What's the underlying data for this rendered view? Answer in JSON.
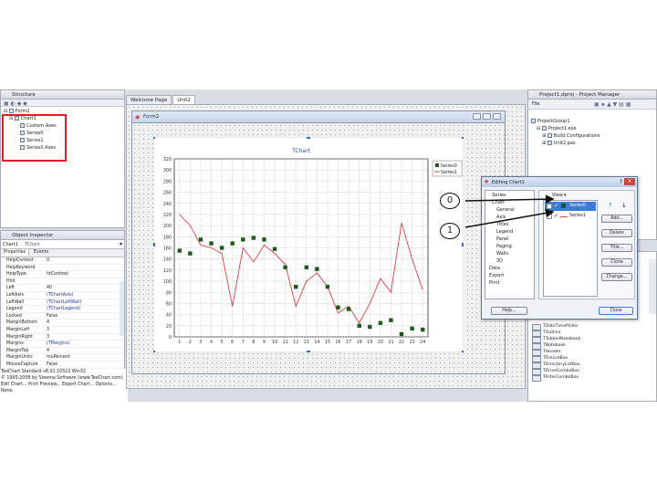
{
  "structure": {
    "title": "Structure",
    "tree": [
      "Form2",
      "Chart1",
      "Custom Axes",
      "Series0",
      "Series1",
      "Series0 Axes"
    ]
  },
  "inspector": {
    "title": "Object Inspector",
    "selector": "Chart1",
    "selector_type": "TChart",
    "tabs": [
      "Properties",
      "Events"
    ],
    "rows": [
      {
        "name": "HelpContext",
        "value": "0"
      },
      {
        "name": "HelpKeyword",
        "value": ""
      },
      {
        "name": "HelpType",
        "value": "htContext"
      },
      {
        "name": "Hint",
        "value": ""
      },
      {
        "name": "Left",
        "value": "40"
      },
      {
        "name": "LeftAxis",
        "value": "(TChartAxis)"
      },
      {
        "name": "LeftWall",
        "value": "(TChartLeftWall)"
      },
      {
        "name": "Legend",
        "value": "(TChartLegend)"
      },
      {
        "name": "Locked",
        "value": "False"
      },
      {
        "name": "MarginBottom",
        "value": "4"
      },
      {
        "name": "MarginLeft",
        "value": "3"
      },
      {
        "name": "MarginRight",
        "value": "3"
      },
      {
        "name": "Margins",
        "value": "(TMargins)"
      },
      {
        "name": "MarginTop",
        "value": "4"
      },
      {
        "name": "MarginUnits",
        "value": "muPercent"
      },
      {
        "name": "MouseCapture",
        "value": "False"
      },
      {
        "name": "Name",
        "value": "Chart1"
      }
    ],
    "status": [
      "TeeChart Standard v8.01.10522 Win32",
      "© 1995-2008 by Steema Software (www.TeeChart.com)",
      "Edit Chart... Print Preview... Export Chart... Options..."
    ],
    "footer": "None"
  },
  "tabs": [
    "Welcome Page",
    "Unit2"
  ],
  "form": {
    "title": "Form2"
  },
  "chart_data": {
    "type": "line",
    "title": "TChart",
    "x": [
      1,
      2,
      3,
      4,
      5,
      6,
      7,
      8,
      9,
      10,
      11,
      12,
      13,
      14,
      15,
      16,
      17,
      18,
      19,
      20,
      21,
      22,
      23,
      24
    ],
    "ylim": [
      0,
      320
    ],
    "yticks": [
      0,
      20,
      40,
      60,
      80,
      100,
      120,
      140,
      160,
      180,
      200,
      220,
      240,
      260,
      280,
      300,
      320
    ],
    "grid": true,
    "legend_position": "top-right",
    "series": [
      {
        "name": "Series0",
        "style": "points",
        "color": "#1e5a1e",
        "values": [
          155,
          150,
          175,
          168,
          160,
          168,
          175,
          178,
          175,
          158,
          125,
          90,
          125,
          122,
          90,
          53,
          50,
          20,
          18,
          25,
          30,
          5,
          15,
          13
        ]
      },
      {
        "name": "Series1",
        "style": "line",
        "color": "#e0403f",
        "values": [
          220,
          200,
          165,
          160,
          150,
          55,
          160,
          135,
          165,
          150,
          130,
          55,
          100,
          115,
          90,
          43,
          55,
          25,
          60,
          105,
          80,
          205,
          140,
          85
        ]
      }
    ]
  },
  "editor": {
    "title": "Editing Chart1",
    "tree": [
      "Series",
      "Chart",
      "General",
      "Axis",
      "Titles",
      "Legend",
      "Panel",
      "Paging",
      "Walls",
      "3D",
      "Data",
      "Export",
      "Print"
    ],
    "view_label": "View",
    "series_list": [
      "Series0",
      "Series1"
    ],
    "buttons": [
      "Add...",
      "Delete",
      "Title...",
      "Clone",
      "Change..."
    ],
    "help_label": "Help...",
    "close_label": "Close"
  },
  "callouts": [
    "0",
    "1"
  ],
  "project": {
    "title": "Project1.dproj - Project Manager",
    "file_label": "File",
    "tree": [
      "ProjectGroup1",
      "Project1.exe",
      "Build Configurations",
      "Unit2.pas"
    ]
  },
  "palette": {
    "items": [
      "TDateTimePicker",
      "TOutline",
      "TTabbedNotebook",
      "TNotebook",
      "THeader",
      "TFileListBox",
      "TDirectoryListBox",
      "TDriveComboBox",
      "TFilterComboBox"
    ]
  },
  "colors": {
    "series0": "#1e5a1e",
    "series1": "#e0403f",
    "highlight": "#e02020",
    "accent": "#2a6fd0"
  }
}
